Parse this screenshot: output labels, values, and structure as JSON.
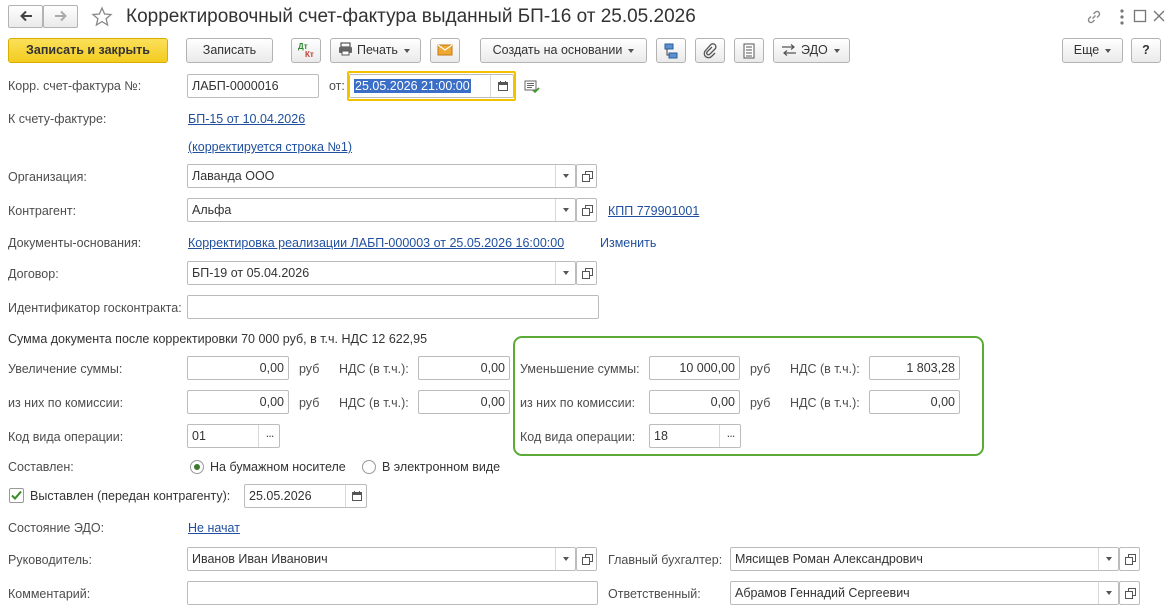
{
  "window": {
    "title": "Корректировочный счет-фактура выданный БП-16 от 25.05.2026"
  },
  "toolbar": {
    "save_close": "Записать и закрыть",
    "save": "Записать",
    "dtkt_icon_text_top": "Дт",
    "dtkt_icon_text_bottom": "Кт",
    "print": "Печать",
    "create_based_on": "Создать на основании",
    "edo": "ЭДО",
    "more": "Еще",
    "help": "?"
  },
  "form": {
    "corr_invoice_label": "Корр. счет-фактура №:",
    "corr_invoice_number": "ЛАБП-0000016",
    "date_label": "от:",
    "date_value": "25.05.2026 21:00:00",
    "to_invoice_label": "К счету-фактуре:",
    "to_invoice_link": "БП-15 от 10.04.2026",
    "corrected_line_link": "(корректируется строка №1)",
    "organization_label": "Организация:",
    "organization_value": "Лаванда ООО",
    "counterparty_label": "Контрагент:",
    "counterparty_value": "Альфа",
    "kpp_link": "КПП 779901001",
    "base_docs_label": "Документы-основания:",
    "base_docs_link": "Корректировка реализации ЛАБП-000003 от 25.05.2026 16:00:00",
    "change_link": "Изменить",
    "contract_label": "Договор:",
    "contract_value": "БП-19 от 05.04.2026",
    "gov_contract_label": "Идентификатор госконтракта:",
    "gov_contract_value": "",
    "total_text": "Сумма документа после корректировки 70 000 руб, в т.ч. НДС 12 622,95",
    "increase_label": "Увеличение суммы:",
    "increase_value": "0,00",
    "rub_1": "руб",
    "vat_label_1": "НДС (в т.ч.):",
    "increase_vat_value": "0,00",
    "commission_label_1": "из них по комиссии:",
    "commission_inc_value": "0,00",
    "rub_2": "руб",
    "vat_label_2": "НДС (в т.ч.):",
    "commission_inc_vat_value": "0,00",
    "op_code_label_1": "Код вида операции:",
    "op_code_value_1": "01",
    "decrease_label": "Уменьшение суммы:",
    "decrease_value": "10 000,00",
    "rub_3": "руб",
    "vat_label_3": "НДС (в т.ч.):",
    "decrease_vat_value": "1 803,28",
    "commission_label_2": "из них по комиссии:",
    "commission_dec_value": "0,00",
    "rub_4": "руб",
    "vat_label_4": "НДС (в т.ч.):",
    "commission_dec_vat_value": "0,00",
    "op_code_label_2": "Код вида операции:",
    "op_code_value_2": "18",
    "compiled_label": "Составлен:",
    "paper_option": "На бумажном носителе",
    "electronic_option": "В электронном виде",
    "issued_label": "Выставлен (передан контрагенту):",
    "issued_checked": true,
    "issued_date": "25.05.2026",
    "edo_state_label": "Состояние ЭДО:",
    "edo_state_link": "Не начат",
    "head_label": "Руководитель:",
    "head_value": "Иванов Иван Иванович",
    "chief_accountant_label": "Главный бухгалтер:",
    "chief_accountant_value": "Мясищев Роман Александрович",
    "comment_label": "Комментарий:",
    "comment_value": "",
    "responsible_label": "Ответственный:",
    "responsible_value": "Абрамов Геннадий Сергеевич"
  },
  "colors": {
    "accent_button": "#f7d22f",
    "highlight_frame": "#5aac37",
    "link": "#1f4f9e",
    "date_focus": "#f2c200",
    "selection": "#3a6ec7"
  }
}
